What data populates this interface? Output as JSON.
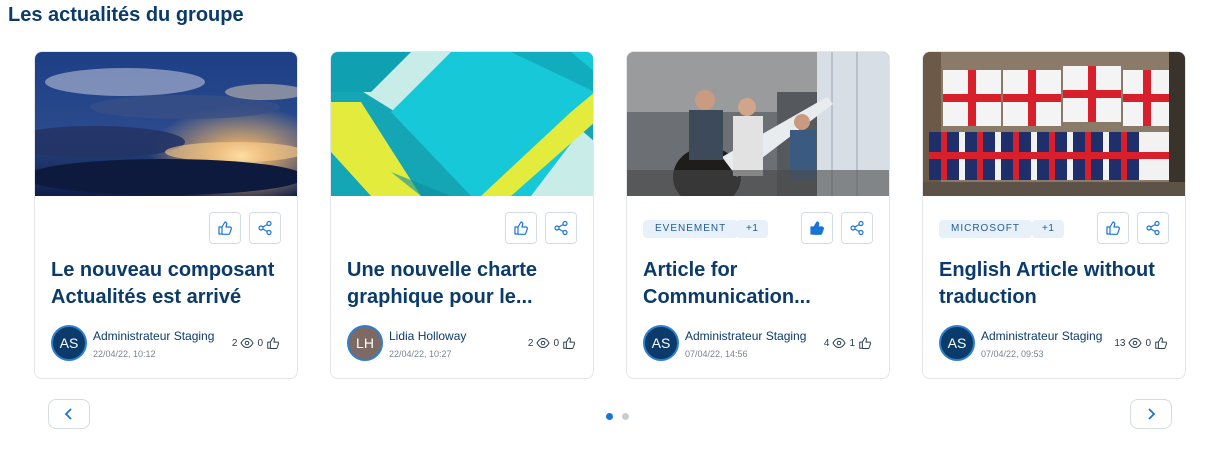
{
  "section": {
    "title": "Les actualités du groupe"
  },
  "cards": [
    {
      "title": "Le nouveau composant Actualités est arrivé",
      "tags": [],
      "liked": false,
      "author": {
        "initials": "AS",
        "name": "Administrateur Staging",
        "date": "22/04/22, 10:12"
      },
      "stats": {
        "views": "2",
        "likes": "0"
      },
      "image": "sunset-clouds-photo"
    },
    {
      "title": "Une nouvelle charte graphique pour le...",
      "tags": [],
      "liked": false,
      "author": {
        "initials": "LH",
        "name": "Lidia Holloway",
        "date": "22/04/22, 10:27"
      },
      "stats": {
        "views": "2",
        "likes": "0"
      },
      "image": "geometric-teal-pattern"
    },
    {
      "title": "Article for Communication...",
      "tags": [
        "EVENEMENT",
        "+1"
      ],
      "liked": true,
      "author": {
        "initials": "AS",
        "name": "Administrateur Staging",
        "date": "07/04/22, 14:56"
      },
      "stats": {
        "views": "4",
        "likes": "1"
      },
      "image": "office-team-photo"
    },
    {
      "title": "English Article without traduction",
      "tags": [
        "MICROSOFT",
        "+1"
      ],
      "liked": false,
      "author": {
        "initials": "AS",
        "name": "Administrateur Staging",
        "date": "07/04/22, 09:53"
      },
      "stats": {
        "views": "13",
        "likes": "0"
      },
      "image": "union-jack-flags-photo"
    }
  ],
  "pagination": {
    "pages": 2,
    "current": 1
  },
  "icons": {
    "like": "thumbs-up-icon",
    "share": "share-icon",
    "views": "eye-icon",
    "prev": "chevron-left-icon",
    "next": "chevron-right-icon"
  },
  "colors": {
    "accent": "#1a73d6",
    "title": "#0b3b6b",
    "tag_bg": "#e8f0fa"
  }
}
